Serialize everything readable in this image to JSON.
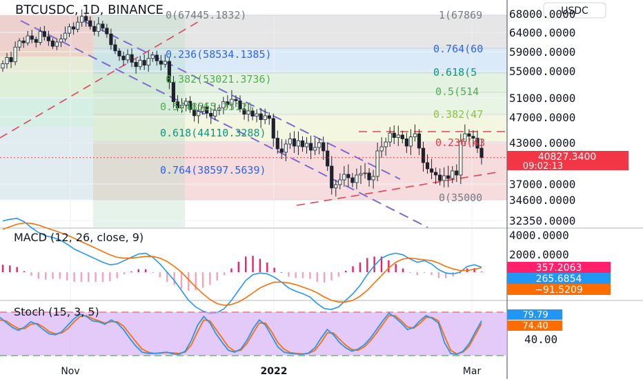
{
  "header": {
    "symbol": "BTCUSDC, 1D, BINANCE",
    "currency_button": "USDC"
  },
  "chart_data": [
    {
      "type": "candlestick",
      "pane": "price",
      "x_tick_labels": [
        "Nov",
        "2022",
        "Mar"
      ],
      "y_tick_labels": [
        "68000.0000",
        "64000.0000",
        "59000.0000",
        "55000.0000",
        "51000.0000",
        "47000.0000",
        "43000.0000",
        "37000.0000",
        "34600.0000",
        "32350.0000"
      ],
      "last_price": "40827.3400",
      "countdown": "09:02:13",
      "fib_left": [
        {
          "label": "0(67445.1832)",
          "color": "#787b86"
        },
        {
          "label": "0.236(58534.1385)",
          "color": "#2962ff"
        },
        {
          "label": "0.382(53021.3736)",
          "color": "#4caf50"
        },
        {
          "label": "0.5(48565.3512)",
          "color": "#4caf50"
        },
        {
          "label": "0.618(44110.3288)",
          "color": "#089981"
        },
        {
          "label": "0.764(38597.5639)",
          "color": "#2962ff"
        }
      ],
      "fib_right": [
        {
          "label": "1(67869",
          "color": "#787b86"
        },
        {
          "label": "0.764(60",
          "color": "#2962ff"
        },
        {
          "label": "0.618(5",
          "color": "#089981"
        },
        {
          "label": "0.5(514",
          "color": "#4caf50"
        },
        {
          "label": "0.382(47",
          "color": "#8bc34a"
        },
        {
          "label": "0.236(43",
          "color": "#f23645"
        },
        {
          "label": "0(35000",
          "color": "#787b86"
        }
      ],
      "closes": [
        56500,
        57800,
        56900,
        60200,
        61800,
        61300,
        63100,
        62200,
        61400,
        64200,
        62900,
        61800,
        60400,
        61500,
        62300,
        63800,
        65200,
        64700,
        66200,
        67445,
        66500,
        65300,
        64200,
        65800,
        64900,
        63600,
        60800,
        59200,
        58100,
        57300,
        58400,
        56800,
        55900,
        57200,
        56200,
        57600,
        58300,
        57100,
        56400,
        57000,
        53300,
        50200,
        48900,
        49500,
        50300,
        48600,
        47300,
        48200,
        49100,
        47800,
        47200,
        48400,
        48900,
        50200,
        49600,
        50700,
        50400,
        48700,
        47600,
        48300,
        47200,
        47700,
        46600,
        47300,
        46800,
        43700,
        42100,
        41600,
        42800,
        43600,
        42500,
        43300,
        42400,
        42900,
        41900,
        42300,
        43000,
        41800,
        39600,
        36400,
        36900,
        37600,
        38400,
        37900,
        37200,
        38300,
        38500,
        38600,
        37600,
        38100,
        41800,
        42400,
        43100,
        44500,
        43800,
        44200,
        43600,
        42500,
        43900,
        44400,
        42200,
        40100,
        39200,
        38700,
        38300,
        37500,
        38200,
        37800,
        38900,
        38300,
        43200,
        44400,
        44000,
        43700,
        42200,
        40827
      ]
    },
    {
      "type": "line",
      "pane": "macd",
      "title": "MACD (12, 26, close, 9)",
      "y_tick_labels": [
        "4000.0000",
        "2000.0000",
        "0.0000"
      ],
      "values": {
        "histogram": "357.2063",
        "macd": "265.6854",
        "signal": "−91.5209"
      },
      "series": [
        {
          "name": "MACD",
          "color": "#2196f3",
          "values": [
            3100,
            3200,
            3250,
            3050,
            2700,
            2400,
            2200,
            2100,
            1950,
            1700,
            1400,
            1200,
            1000,
            800,
            600,
            450,
            500,
            700,
            900,
            1100,
            1150,
            900,
            500,
            0,
            -500,
            -1100,
            -1700,
            -2100,
            -2350,
            -2500,
            -2450,
            -2200,
            -1700,
            -1100,
            -500,
            -150,
            -50,
            -100,
            -300,
            -600,
            -950,
            -1150,
            -1300,
            -1500,
            -1900,
            -2200,
            -2250,
            -2100,
            -1700,
            -1300,
            -800,
            -150,
            400,
            850,
            1050,
            1150,
            1050,
            800,
            600,
            700,
            500,
            150,
            -50,
            -100,
            0,
            350,
            450,
            300
          ]
        },
        {
          "name": "Signal",
          "color": "#ff6d00",
          "values": [
            2600,
            2750,
            2900,
            2980,
            2950,
            2850,
            2700,
            2550,
            2400,
            2250,
            2050,
            1850,
            1650,
            1450,
            1250,
            1050,
            900,
            850,
            850,
            900,
            950,
            950,
            850,
            650,
            350,
            0,
            -450,
            -900,
            -1300,
            -1650,
            -1900,
            -2000,
            -1950,
            -1800,
            -1550,
            -1250,
            -950,
            -750,
            -600,
            -600,
            -650,
            -750,
            -900,
            -1050,
            -1250,
            -1500,
            -1700,
            -1800,
            -1800,
            -1700,
            -1450,
            -1100,
            -650,
            -200,
            250,
            600,
            800,
            850,
            800,
            750,
            700,
            550,
            350,
            200,
            100,
            100,
            180,
            265
          ]
        }
      ]
    },
    {
      "type": "line",
      "pane": "stoch",
      "title": "Stoch (15, 3, 5)",
      "y_tick_labels": [
        "40.00"
      ],
      "values": {
        "k": "79.79",
        "d": "74.40"
      },
      "series": [
        {
          "name": "%K",
          "color": "#2196f3",
          "values": [
            88,
            76,
            65,
            58,
            66,
            78,
            72,
            60,
            50,
            48,
            55,
            70,
            85,
            95,
            90,
            80,
            78,
            72,
            82,
            75,
            60,
            40,
            22,
            8,
            5,
            5,
            6,
            8,
            4,
            3,
            10,
            35,
            70,
            90,
            75,
            50,
            30,
            12,
            8,
            15,
            35,
            62,
            82,
            70,
            45,
            20,
            8,
            5,
            4,
            3,
            6,
            18,
            40,
            60,
            48,
            30,
            18,
            10,
            15,
            25,
            40,
            60,
            80,
            98,
            88,
            75,
            60,
            65,
            80,
            92,
            86,
            75,
            30,
            5,
            3,
            10,
            28,
            55,
            80
          ]
        },
        {
          "name": "%D",
          "color": "#ff6d00",
          "values": [
            82,
            80,
            70,
            62,
            62,
            72,
            74,
            66,
            55,
            50,
            52,
            62,
            78,
            90,
            92,
            85,
            80,
            75,
            78,
            78,
            68,
            50,
            32,
            15,
            8,
            5,
            6,
            7,
            6,
            5,
            8,
            25,
            55,
            82,
            80,
            60,
            40,
            20,
            10,
            12,
            28,
            52,
            75,
            75,
            55,
            30,
            15,
            7,
            5,
            4,
            5,
            12,
            30,
            52,
            52,
            38,
            24,
            14,
            12,
            20,
            34,
            52,
            72,
            92,
            92,
            80,
            66,
            63,
            74,
            88,
            88,
            80,
            45,
            12,
            4,
            8,
            22,
            48,
            74
          ]
        }
      ]
    }
  ]
}
